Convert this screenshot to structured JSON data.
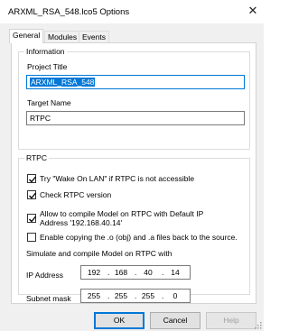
{
  "window": {
    "title": "ARXML_RSA_548.lco5 Options",
    "close_symbol": "✕"
  },
  "tabs": [
    {
      "label": "General",
      "active": true
    },
    {
      "label": "Modules",
      "active": false
    },
    {
      "label": "Events",
      "active": false
    }
  ],
  "information": {
    "group_label": "Information",
    "project_title_label": "Project Title",
    "project_title_value": "ARXML_RSA_548",
    "target_name_label": "Target Name",
    "target_name_value": "RTPC"
  },
  "rtpc": {
    "group_label": "RTPC",
    "options": [
      {
        "label": "Try \"Wake On LAN\" if RTPC is not accessible",
        "checked": true
      },
      {
        "label": "Check RTPC version",
        "checked": true
      },
      {
        "label_line1": "Allow to compile Model on RTPC with Default IP",
        "label_line2": "Address '192.168.40.14'",
        "checked": true
      },
      {
        "label": "Enable copying the .o (obj) and .a files back to the source.",
        "checked": false
      }
    ],
    "simulate_label": "Simulate and compile Model on RTPC with",
    "ip_address": {
      "label": "IP Address",
      "octets": [
        "192",
        "168",
        "40",
        "14"
      ]
    },
    "subnet_mask": {
      "label": "Subnet mask",
      "octets": [
        "255",
        "255",
        "255",
        "0"
      ]
    }
  },
  "buttons": {
    "ok": "OK",
    "cancel": "Cancel",
    "help": "Help"
  }
}
